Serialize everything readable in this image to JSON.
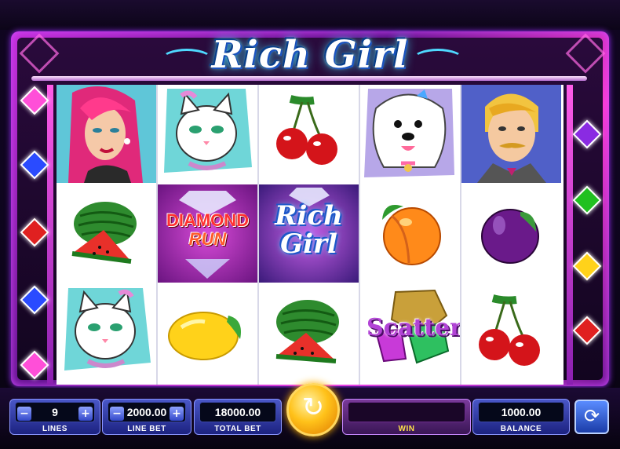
{
  "game": {
    "title": "Rich Girl"
  },
  "colors": {
    "frame": "#c22bd6",
    "accent": "#4fd9ff",
    "panel": "#2a35a8",
    "spin": "#ffc21a"
  },
  "reels": [
    {
      "symbols": [
        "rich-girl-woman",
        "watermelon",
        "cat"
      ]
    },
    {
      "symbols": [
        "cat",
        "diamond-run",
        "lemon"
      ]
    },
    {
      "symbols": [
        "cherries",
        "rich-girl-logo",
        "watermelon"
      ]
    },
    {
      "symbols": [
        "dog",
        "peach",
        "scatter"
      ]
    },
    {
      "symbols": [
        "butler",
        "plum",
        "cherries"
      ]
    }
  ],
  "symbol_text": {
    "diamond_run_line1": "DIAMOND",
    "diamond_run_line2": "RUN",
    "rich_girl_line1": "Rich",
    "rich_girl_line2": "Girl",
    "scatter": "Scatter"
  },
  "controls": {
    "lines": {
      "value": "9",
      "label": "LINES"
    },
    "line_bet": {
      "value": "2000.00",
      "label": "LINE BET"
    },
    "total_bet": {
      "value": "18000.00",
      "label": "TOTAL BET"
    },
    "win": {
      "value": "",
      "label": "WIN"
    },
    "balance": {
      "value": "1000.00",
      "label": "BALANCE"
    },
    "minus": "−",
    "plus": "+",
    "spin_icon": "↻",
    "autoplay_icon": "⟳"
  },
  "side_gems": {
    "left": [
      "#ff4fd8",
      "#2a4bff",
      "#e02020",
      "#2a4bff",
      "#ff4fd8"
    ],
    "right": [
      "#8a2be2",
      "#20c020",
      "#ffd21a",
      "#e02020"
    ]
  }
}
